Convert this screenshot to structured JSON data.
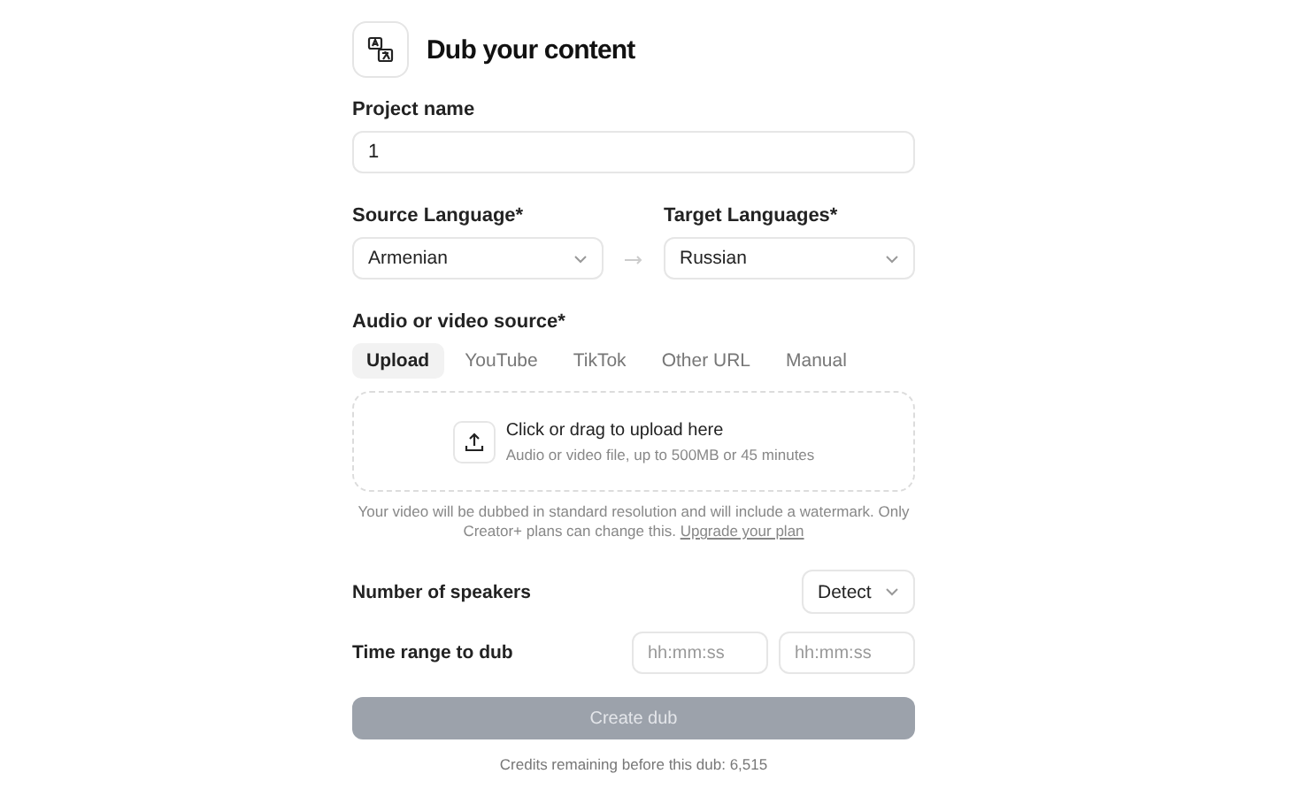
{
  "header": {
    "title": "Dub your content"
  },
  "project_name": {
    "label": "Project name",
    "value": "1"
  },
  "source_language": {
    "label": "Source Language*",
    "value": "Armenian"
  },
  "target_languages": {
    "label": "Target Languages*",
    "value": "Russian"
  },
  "source": {
    "label": "Audio or video source*",
    "tabs": [
      {
        "label": "Upload",
        "selected": true
      },
      {
        "label": "YouTube",
        "selected": false
      },
      {
        "label": "TikTok",
        "selected": false
      },
      {
        "label": "Other URL",
        "selected": false
      },
      {
        "label": "Manual",
        "selected": false
      }
    ],
    "upload": {
      "title": "Click or drag to upload here",
      "hint": "Audio or video file, up to 500MB or 45 minutes"
    },
    "note": {
      "text": "Your video will be dubbed in standard resolution and will include a watermark. Only Creator+ plans can change this.",
      "link": "Upgrade your plan"
    }
  },
  "speakers": {
    "label": "Number of speakers",
    "value": "Detect"
  },
  "time_range": {
    "label": "Time range to dub",
    "start": {
      "placeholder": "hh:mm:ss"
    },
    "end": {
      "placeholder": "hh:mm:ss"
    }
  },
  "submit": {
    "label": "Create dub",
    "disabled": true
  },
  "credits": "Credits remaining before this dub: 6,515"
}
